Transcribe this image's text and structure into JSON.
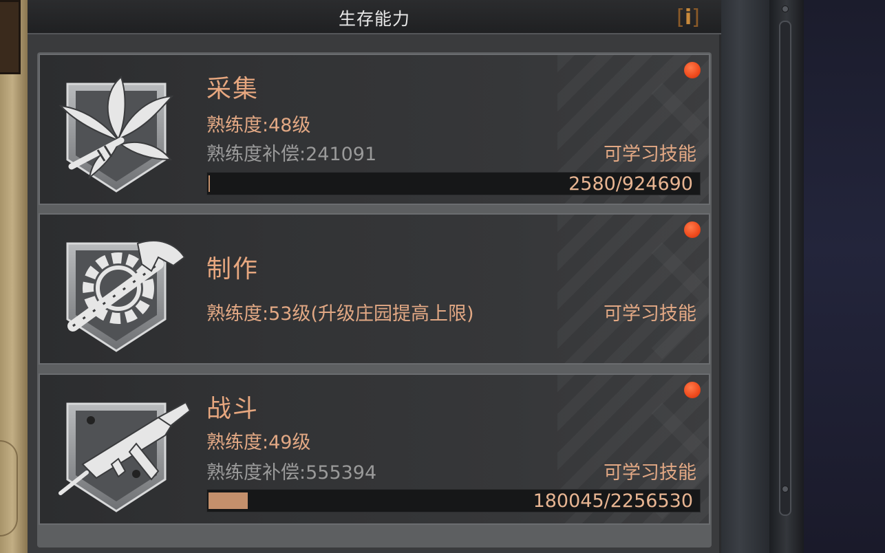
{
  "header": {
    "title": "生存能力",
    "info_label": "i"
  },
  "colors": {
    "accent": "#e2a884",
    "notify": "#ef4a1c",
    "progress_fill": "#c4906c"
  },
  "cards": [
    {
      "icon": "leaf-bundle-icon",
      "title": "采集",
      "level_label": "熟练度:48级",
      "comp_label": "熟练度补偿:241091",
      "learn_label": "可学习技能",
      "progress_text": "2580/924690",
      "progress": 0.0028,
      "has_notification": true
    },
    {
      "icon": "hammer-gear-icon",
      "title": "制作",
      "level_label": "熟练度:53级(升级庄园提高上限)",
      "learn_label": "可学习技能",
      "has_notification": true
    },
    {
      "icon": "submachine-gun-icon",
      "title": "战斗",
      "level_label": "熟练度:49级",
      "comp_label": "熟练度补偿:555394",
      "learn_label": "可学习技能",
      "progress_text": "180045/2256530",
      "progress": 0.0798,
      "has_notification": true
    }
  ]
}
